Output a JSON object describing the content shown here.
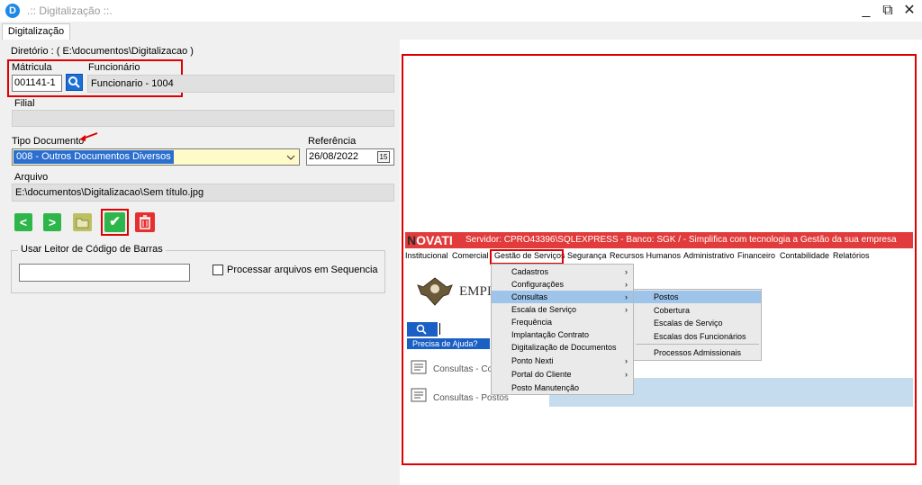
{
  "window": {
    "app_icon": "D",
    "title": ".:: Digitalização ::.",
    "minimize": "_",
    "restore": "⧉",
    "close": "✕"
  },
  "tabs": [
    {
      "label": "Digitalização"
    }
  ],
  "form": {
    "diretorio": "Diretório : ( E:\\documentos\\Digitalizacao )",
    "matricula_label": "Mátricula",
    "matricula_value": "001141-1",
    "funcionario_label": "Funcionário",
    "funcionario_value": "Funcionario - 1004",
    "filial_label": "Filial",
    "filial_value": "",
    "tipo_documento_label": "Tipo Documento",
    "tipo_documento_value": "008 - Outros Documentos Diversos",
    "referencia_label": "Referência",
    "referencia_value": "26/08/2022",
    "calendar_icon": "15",
    "arquivo_label": "Arquivo",
    "arquivo_value": "E:\\documentos\\Digitalizacao\\Sem título.jpg",
    "barcode_group_label": "Usar Leitor de Código de Barras",
    "barcode_input": "",
    "processar_label": "Processar arquivos em Sequencia"
  },
  "toolbar": {
    "prev": "<",
    "next": ">",
    "folder": "folder-icon",
    "confirm": "✔",
    "delete": "🗑"
  },
  "preview": {
    "logo_n": "N",
    "logo_rest": "OVATI",
    "header": "Servidor: CPRO43396\\SQLEXPRESS - Banco: SGK /  - Simplifica com tecnologia a Gestão da sua empresa",
    "menu": [
      "Institucional",
      "Comercial",
      "Gestão de Serviços",
      "Segurança",
      "Recursos Humanos",
      "Administrativo",
      "Financeiro",
      "Contabilidade",
      "Relatórios"
    ],
    "dropdown1": [
      "Cadastros",
      "Configurações",
      "Consultas",
      "Escala de Serviço",
      "Frequência",
      "Implantação Contrato",
      "Digitalização de Documentos",
      "Ponto Nexti",
      "Portal do Cliente",
      "Posto Manutenção"
    ],
    "dropdown2": [
      "Postos",
      "Cobertura",
      "Escalas de Serviço",
      "Escalas dos Funcionários",
      "Processos Admissionais"
    ],
    "emp_text": "EMPI",
    "help_text": "Precisa de Ajuda?",
    "consultas_1": "Consultas - Co",
    "consultas_2": "Consultas - Postos"
  },
  "colors": {
    "accent_red": "#e00000",
    "header_red": "#e23b3b",
    "confirm_green": "#2fb64a",
    "delete_red": "#e53030",
    "search_blue": "#1a6ed8",
    "select_yellow": "#fffbc8"
  }
}
